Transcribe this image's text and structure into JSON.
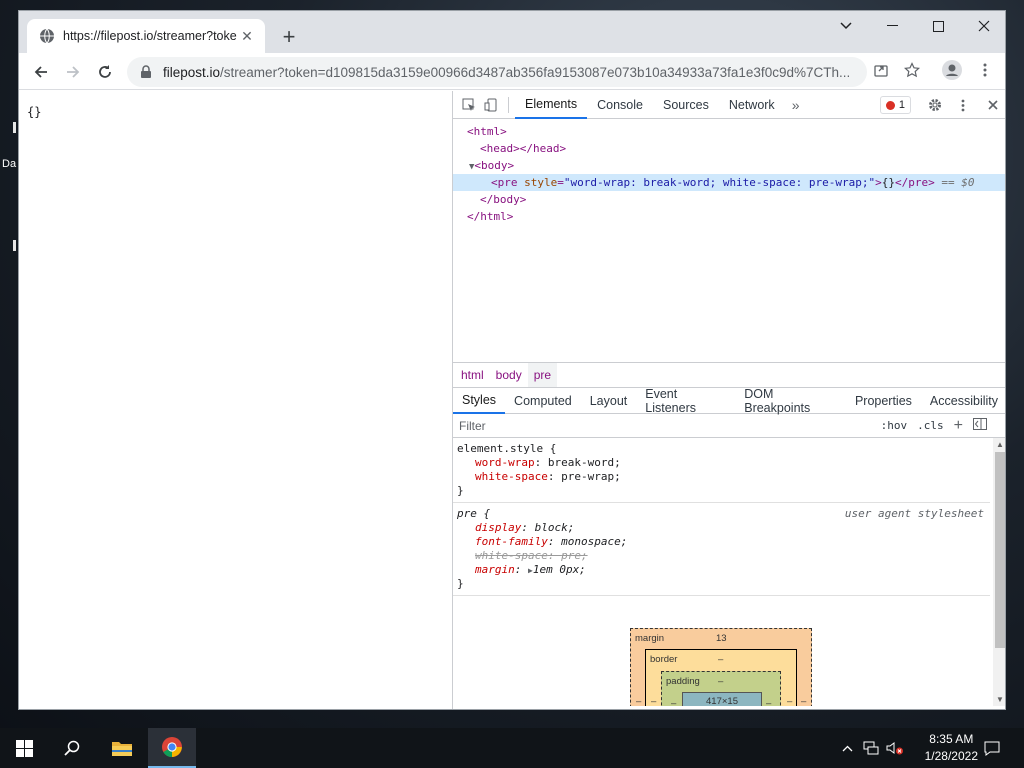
{
  "desktop": {
    "label": "Da"
  },
  "browser": {
    "tab": {
      "title": "https://filepost.io/streamer?toke"
    },
    "address": {
      "host": "filepost.io",
      "path": "/streamer?token=d109815da3159e00966d3487ab356fa9153087e073b10a34933a73fa1e3f0c9d%7CTh..."
    }
  },
  "page": {
    "content": "{}"
  },
  "devtools": {
    "tabs": [
      "Elements",
      "Console",
      "Sources",
      "Network"
    ],
    "active_tab": "Elements",
    "error_count": "1",
    "dom": {
      "html_open": "<html>",
      "head": "<head></head>",
      "body_open": "<body>",
      "pre_tag": "<pre",
      "pre_attr_name": "style",
      "pre_attr_value": "\"word-wrap: break-word; white-space: pre-wrap;\"",
      "pre_gt": ">",
      "pre_text": "{}",
      "pre_close": "</pre>",
      "pre_marker": "== $0",
      "body_close": "</body>",
      "html_close": "</html>"
    },
    "breadcrumbs": [
      "html",
      "body",
      "pre"
    ],
    "subtabs": [
      "Styles",
      "Computed",
      "Layout",
      "Event Listeners",
      "DOM Breakpoints",
      "Properties",
      "Accessibility"
    ],
    "filter": {
      "placeholder": "Filter",
      "hov": ":hov",
      "cls": ".cls"
    },
    "styles": {
      "element_style": {
        "selector": "element.style {",
        "props": [
          {
            "name": "word-wrap",
            "value": "break-word;"
          },
          {
            "name": "white-space",
            "value": "pre-wrap;"
          }
        ],
        "close": "}"
      },
      "pre_rule": {
        "selector": "pre {",
        "source": "user agent stylesheet",
        "props": [
          {
            "name": "display",
            "value": "block;"
          },
          {
            "name": "font-family",
            "value": "monospace;"
          },
          {
            "name": "white-space",
            "value": "pre;"
          },
          {
            "name": "margin",
            "value": "1em 0px;"
          }
        ],
        "close": "}"
      }
    },
    "box_model": {
      "margin_label": "margin",
      "margin_value": "13",
      "border_label": "border",
      "border_value": "–",
      "padding_label": "padding",
      "padding_value": "–",
      "content": "417×15",
      "dash": "–"
    }
  },
  "taskbar": {
    "time": "8:35 AM",
    "date": "1/28/2022"
  }
}
